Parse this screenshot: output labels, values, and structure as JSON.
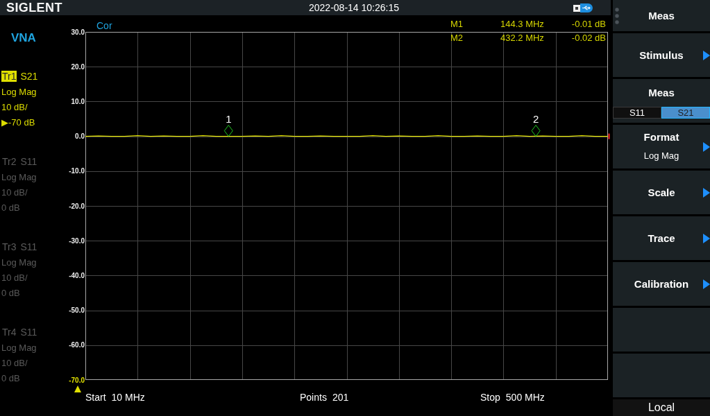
{
  "top_bar": {
    "logo": "SIGLENT",
    "datetime": "2022-08-14 10:26:15"
  },
  "left_panel": {
    "mode": "VNA",
    "traces": [
      {
        "label": "Tr1",
        "parameter": "S21",
        "format": "Log Mag",
        "scale": "10 dB/",
        "reference": "▶-70 dB",
        "selected": true
      },
      {
        "label": "Tr2",
        "parameter": "S11",
        "format": "Log Mag",
        "scale": "10 dB/",
        "reference": "0 dB",
        "selected": false
      },
      {
        "label": "Tr3",
        "parameter": "S11",
        "format": "Log Mag",
        "scale": "10 dB/",
        "reference": "0 dB",
        "selected": false
      },
      {
        "label": "Tr4",
        "parameter": "S11",
        "format": "Log Mag",
        "scale": "10 dB/",
        "reference": "0 dB",
        "selected": false
      }
    ]
  },
  "plot": {
    "correction": "Cor",
    "markers": [
      {
        "name": "M1",
        "frequency": "144.3 MHz",
        "value": "-0.01 dB",
        "level": 0.274
      },
      {
        "name": "M2",
        "frequency": "432.2 MHz",
        "value": "-0.02 dB",
        "level": 0.862
      }
    ],
    "chart_data": {
      "type": "line",
      "ylim": [
        -70,
        30
      ],
      "yticks": [
        {
          "value": 30,
          "label": "30.0"
        },
        {
          "value": 20,
          "label": "20.0"
        },
        {
          "value": 10,
          "label": "10.0"
        },
        {
          "value": 0,
          "label": "0.0"
        },
        {
          "value": -10,
          "label": "-10.0"
        },
        {
          "value": -20,
          "label": "-20.0"
        },
        {
          "value": -30,
          "label": "-30.0"
        },
        {
          "value": -40,
          "label": "-40.0"
        },
        {
          "value": -50,
          "label": "-50.0"
        },
        {
          "value": -60,
          "label": "-60.0"
        },
        {
          "value": -70,
          "label": "-70.0"
        }
      ],
      "grid": true,
      "categories": [
        null,
        null,
        null,
        null,
        null,
        null,
        null,
        null,
        null,
        null,
        null,
        null,
        null,
        null,
        null,
        null,
        null,
        null,
        null,
        null,
        null,
        null,
        null,
        null,
        null,
        null,
        null,
        null,
        null,
        null,
        null,
        null,
        null,
        null,
        null,
        null,
        null,
        null,
        null,
        null,
        null
      ],
      "values": [
        0,
        0.1,
        0,
        0,
        0.2,
        0,
        0.1,
        0,
        0,
        0.2,
        0,
        0,
        0,
        0.1,
        0,
        0.2,
        0,
        0,
        0.1,
        0,
        0,
        0,
        0.2,
        0,
        0.1,
        0,
        0,
        0.2,
        0,
        0,
        0.1,
        0,
        0,
        0.2,
        0,
        0.1,
        0,
        0,
        0.2,
        0,
        0
      ],
      "annotations": [
        "1",
        "2"
      ]
    },
    "stimulus": [
      {
        "label": "Start",
        "value": "10 MHz"
      },
      {
        "label": "Points",
        "value": "201"
      },
      {
        "label": "Stop",
        "value": "500 MHz"
      }
    ]
  },
  "softkeys": {
    "items": [
      {
        "kind": "title",
        "label": "Meas"
      },
      {
        "kind": "submenu",
        "label": "Stimulus"
      },
      {
        "kind": "toggle",
        "label": "Meas",
        "options": [
          {
            "label": "S11",
            "selected": false
          },
          {
            "label": "S21",
            "selected": true
          }
        ]
      },
      {
        "kind": "submenu",
        "label": "Format",
        "value": "Log Mag"
      },
      {
        "kind": "submenu",
        "label": "Scale"
      },
      {
        "kind": "submenu",
        "label": "Trace"
      },
      {
        "kind": "submenu",
        "label": "Calibration"
      },
      {
        "kind": "blank"
      },
      {
        "kind": "blank"
      }
    ],
    "footer": "Local"
  }
}
